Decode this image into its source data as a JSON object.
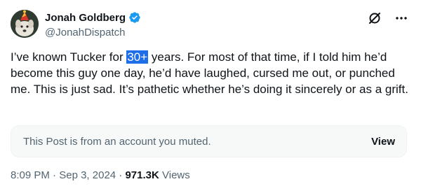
{
  "author": {
    "name": "Jonah Goldberg",
    "handle": "@JonahDispatch",
    "verified": true,
    "avatar_icon": "dog-with-party-hat-avatar"
  },
  "actions": {
    "grok_icon": "grok-slash-icon",
    "more_icon": "more-dots-icon"
  },
  "tweet": {
    "text_before": "I’ve known Tucker for ",
    "highlighted": "30+",
    "text_after": " years. For most of that time, if I told him he’d become this guy one day, he’d have laughed, cursed me out, or punched me. This is just sad. It’s pathetic whether he’s doing it sincerely or as a grift."
  },
  "muted_notice": {
    "text": "This Post is from an account you muted.",
    "view_label": "View"
  },
  "meta": {
    "time": "8:09 PM",
    "sep1": " · ",
    "date": "Sep 3, 2024",
    "sep2": " · ",
    "views_count": "971.3K",
    "views_label": " Views"
  },
  "colors": {
    "text_primary": "#0f1419",
    "text_secondary": "#536471",
    "verified_blue": "#1d9bf0",
    "highlight_blue": "#1d6ee8",
    "muted_bg": "#f7f9f9"
  }
}
